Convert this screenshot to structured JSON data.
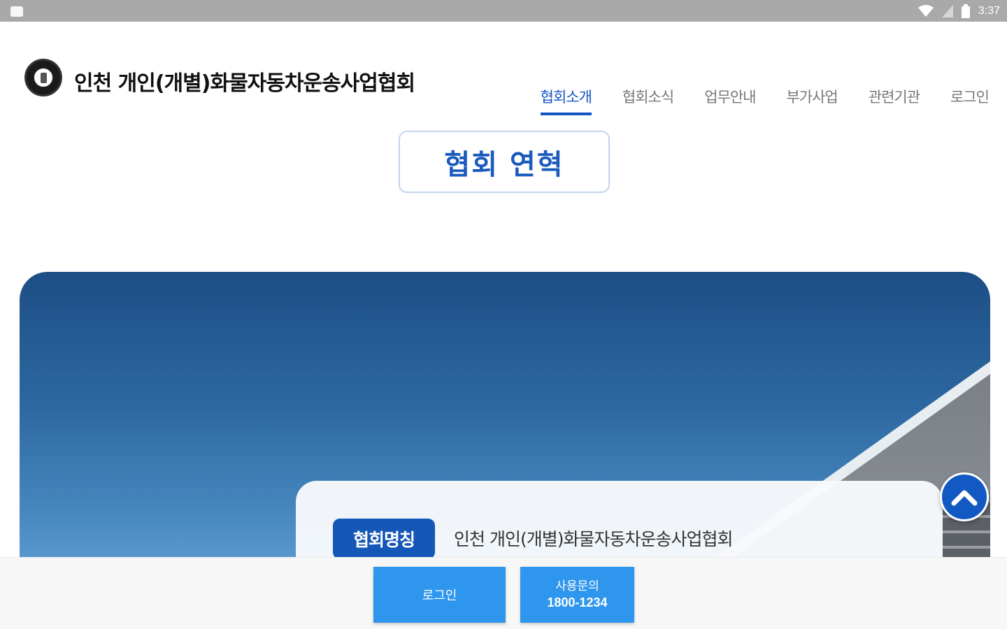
{
  "status_bar": {
    "time": "3:37",
    "icons": [
      "app-notification-icon",
      "wifi-icon",
      "signal-icon",
      "battery-icon"
    ]
  },
  "header": {
    "title": "인천 개인(개별)화물자동차운송사업협회",
    "logo_icon": "association-emblem-icon",
    "nav": [
      {
        "label": "협회소개",
        "active": true
      },
      {
        "label": "협회소식",
        "active": false
      },
      {
        "label": "업무안내",
        "active": false
      },
      {
        "label": "부가사업",
        "active": false
      },
      {
        "label": "관련기관",
        "active": false
      },
      {
        "label": "로그인",
        "active": false
      }
    ]
  },
  "section": {
    "title": "협회 연혁"
  },
  "info_card": {
    "label": "협회명칭",
    "value": "인천 개인(개별)화물자동차운송사업협회"
  },
  "scroll_top": {
    "icon": "chevron-up-icon"
  },
  "bottom_bar": {
    "login_label": "로그인",
    "contact_label": "사용문의",
    "contact_phone": "1800-1234"
  },
  "colors": {
    "accent": "#1456c4",
    "button_blue": "#2f96ed",
    "status_bar": "#a9a9a9"
  }
}
